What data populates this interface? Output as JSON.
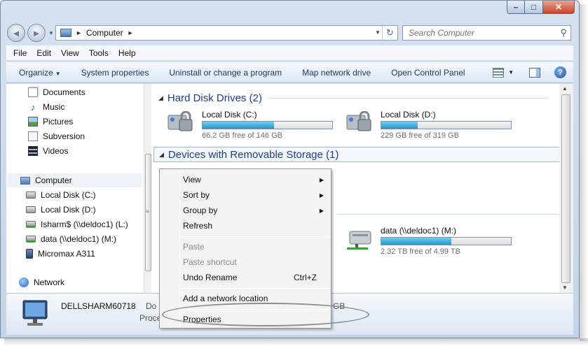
{
  "window": {
    "caption": {
      "min": "–",
      "max": "□",
      "close": "✕"
    }
  },
  "nav": {
    "back": "◄",
    "forward": "►",
    "history_arrow": "▼"
  },
  "address": {
    "crumb": "Computer",
    "sep1": "►",
    "sep2": "►",
    "dropdown": "▼",
    "refresh": "↻"
  },
  "search": {
    "placeholder": "Search Computer",
    "icon": "search-icon"
  },
  "menubar": [
    "File",
    "Edit",
    "View",
    "Tools",
    "Help"
  ],
  "toolbar": {
    "organize": "Organize",
    "organize_arrow": "▼",
    "system_properties": "System properties",
    "uninstall": "Uninstall or change a program",
    "map_drive": "Map network drive",
    "control_panel": "Open Control Panel",
    "view_arrow": "▼",
    "help": "?"
  },
  "sidebar": {
    "items": [
      {
        "label": "Documents",
        "icon": "documents-icon"
      },
      {
        "label": "Music",
        "icon": "music-icon"
      },
      {
        "label": "Pictures",
        "icon": "pictures-icon"
      },
      {
        "label": "Subversion",
        "icon": "subversion-icon"
      },
      {
        "label": "Videos",
        "icon": "videos-icon"
      },
      {
        "label": "Computer",
        "icon": "computer-icon"
      },
      {
        "label": "Local Disk (C:)",
        "icon": "drive-icon"
      },
      {
        "label": "Local Disk (D:)",
        "icon": "drive-icon"
      },
      {
        "label": "Isharm$ (\\\\deldoc1) (L:)",
        "icon": "network-drive-icon"
      },
      {
        "label": "data (\\\\deldoc1) (M:)",
        "icon": "network-drive-icon"
      },
      {
        "label": "Micromax A311",
        "icon": "phone-icon"
      },
      {
        "label": "Network",
        "icon": "network-icon"
      }
    ],
    "grip": "≡"
  },
  "content": {
    "groups": {
      "hdd": "Hard Disk Drives (2)",
      "removable": "Devices with Removable Storage (1)",
      "tri": "◢"
    },
    "drives": [
      {
        "name": "Local Disk (C:)",
        "free": "66.2 GB free of 146 GB",
        "used_pct": 55
      },
      {
        "name": "Local Disk (D:)",
        "free": "229 GB free of 319 GB",
        "used_pct": 28
      },
      {
        "name": "data (\\\\deldoc1) (M:)",
        "free": "2.32 TB free of 4.99 TB",
        "used_pct": 54
      }
    ],
    "scroll_up": "▲",
    "scroll_down": "▼"
  },
  "details": {
    "name": "DELLSHARM60718",
    "domain_fragment": "Do",
    "processor_fragment": "Proce",
    "memory_fragment": "GB"
  },
  "context_menu": {
    "view": "View",
    "sort_by": "Sort by",
    "group_by": "Group by",
    "refresh": "Refresh",
    "paste": "Paste",
    "paste_shortcut": "Paste shortcut",
    "undo_rename": "Undo Rename",
    "undo_shortcut": "Ctrl+Z",
    "add_network_location": "Add a network location",
    "properties": "Properties",
    "submenu_arrow": "▶"
  }
}
